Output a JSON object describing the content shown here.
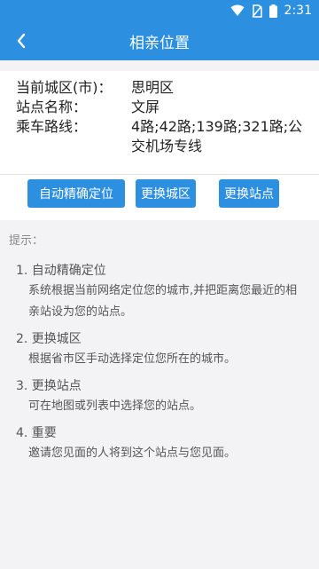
{
  "status_bar": {
    "time": "2:31"
  },
  "header": {
    "title": "相亲位置"
  },
  "info": {
    "city_label": "当前城区(市)：",
    "city_value": "思明区",
    "station_label": "站点名称：",
    "station_value": "文屏",
    "route_label": "乘车路线：",
    "route_value": "4路;42路;139路;321路;公交机场专线"
  },
  "buttons": {
    "auto_locate": "自动精确定位",
    "change_district": "更换城区",
    "change_station": "更换站点"
  },
  "tips": {
    "title": "提示：",
    "items": [
      {
        "head": "1. 自动精确定位",
        "body": "系统根据当前网络定位您的城市,并把距离您最近的相亲站设为您的站点。"
      },
      {
        "head": "2. 更换城区",
        "body": "根据省市区手动选择定位您所在的城市。"
      },
      {
        "head": "3. 更换站点",
        "body": "可在地图或列表中选择您的站点。"
      },
      {
        "head": "4. 重要",
        "body": "邀请您见面的人将到这个站点与您见面。"
      }
    ]
  },
  "colors": {
    "primary": "#2d8fe0",
    "background": "#f3f3f6"
  }
}
